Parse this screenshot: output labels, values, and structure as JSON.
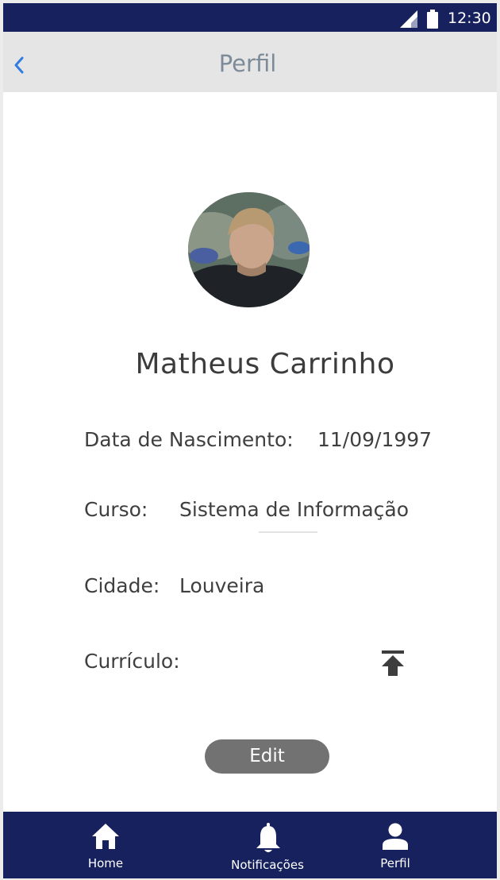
{
  "status_bar": {
    "time": "12:30",
    "icons": [
      "signal-icon",
      "battery-icon"
    ]
  },
  "app_bar": {
    "title": "Perfil",
    "back_icon": "chevron-left-icon"
  },
  "profile": {
    "name": "Matheus Carrinho",
    "fields": {
      "birth_label": "Data de Nascimento:",
      "birth_value": "11/09/1997",
      "course_label": "Curso:",
      "course_value": "Sistema de Informação",
      "city_label": "Cidade:",
      "city_value": "Louveira",
      "cv_label": "Currículo:"
    },
    "upload_icon": "upload-icon",
    "edit_label": "Edit"
  },
  "bottom_nav": {
    "items": [
      {
        "label": "Home",
        "icon": "home-icon"
      },
      {
        "label": "Notificações",
        "icon": "bell-icon"
      },
      {
        "label": "Perfil",
        "icon": "person-icon"
      }
    ]
  },
  "colors": {
    "primary": "#16215d",
    "app_bar_bg": "#e5e5e5",
    "title_text": "#7d8b99",
    "back_accent": "#2f7de0",
    "button_bg": "#727272"
  }
}
